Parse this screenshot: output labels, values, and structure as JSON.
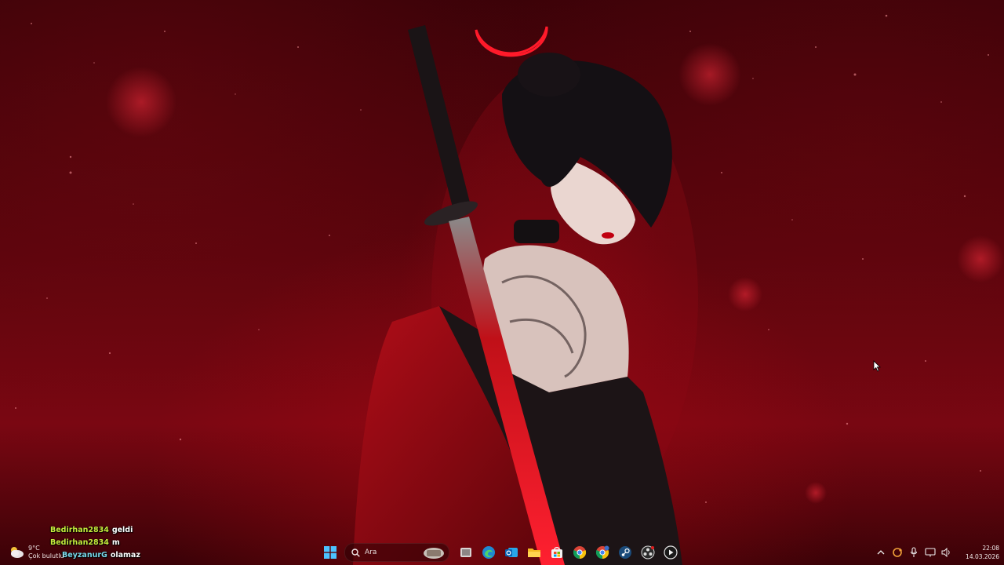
{
  "desktop": {
    "wallpaper": "red-samurai-woman-wallpaper",
    "accent_color": "#7a0712"
  },
  "chat_overlay": {
    "messages": [
      {
        "user": "Bedirhan2834",
        "text": "geldi",
        "user_color": "#c6ea3c"
      },
      {
        "user": "Bedirhan2834",
        "text": "m",
        "user_color": "#c6ea3c"
      },
      {
        "user": "BeyzanurG",
        "text": "olamaz",
        "user_color": "#79d7ea"
      }
    ]
  },
  "taskbar": {
    "weather": {
      "temperature": "9°C",
      "condition": "Çok bulutlu",
      "icon": "cloudy-weather-icon"
    },
    "search": {
      "placeholder": "Ara"
    },
    "apps": [
      "start-icon",
      "search-icon",
      "task-view-icon",
      "edge-icon",
      "outlook-icon",
      "file-explorer-icon",
      "microsoft-store-icon",
      "chrome-icon",
      "chrome-beta-icon",
      "steam-icon",
      "obs-icon",
      "media-player-icon"
    ],
    "tray": {
      "icons": [
        "chevron-up-icon",
        "sync-icon",
        "microphone-icon",
        "network-icon",
        "volume-icon"
      ],
      "time": "22:08",
      "date": "14.03.2026"
    }
  }
}
